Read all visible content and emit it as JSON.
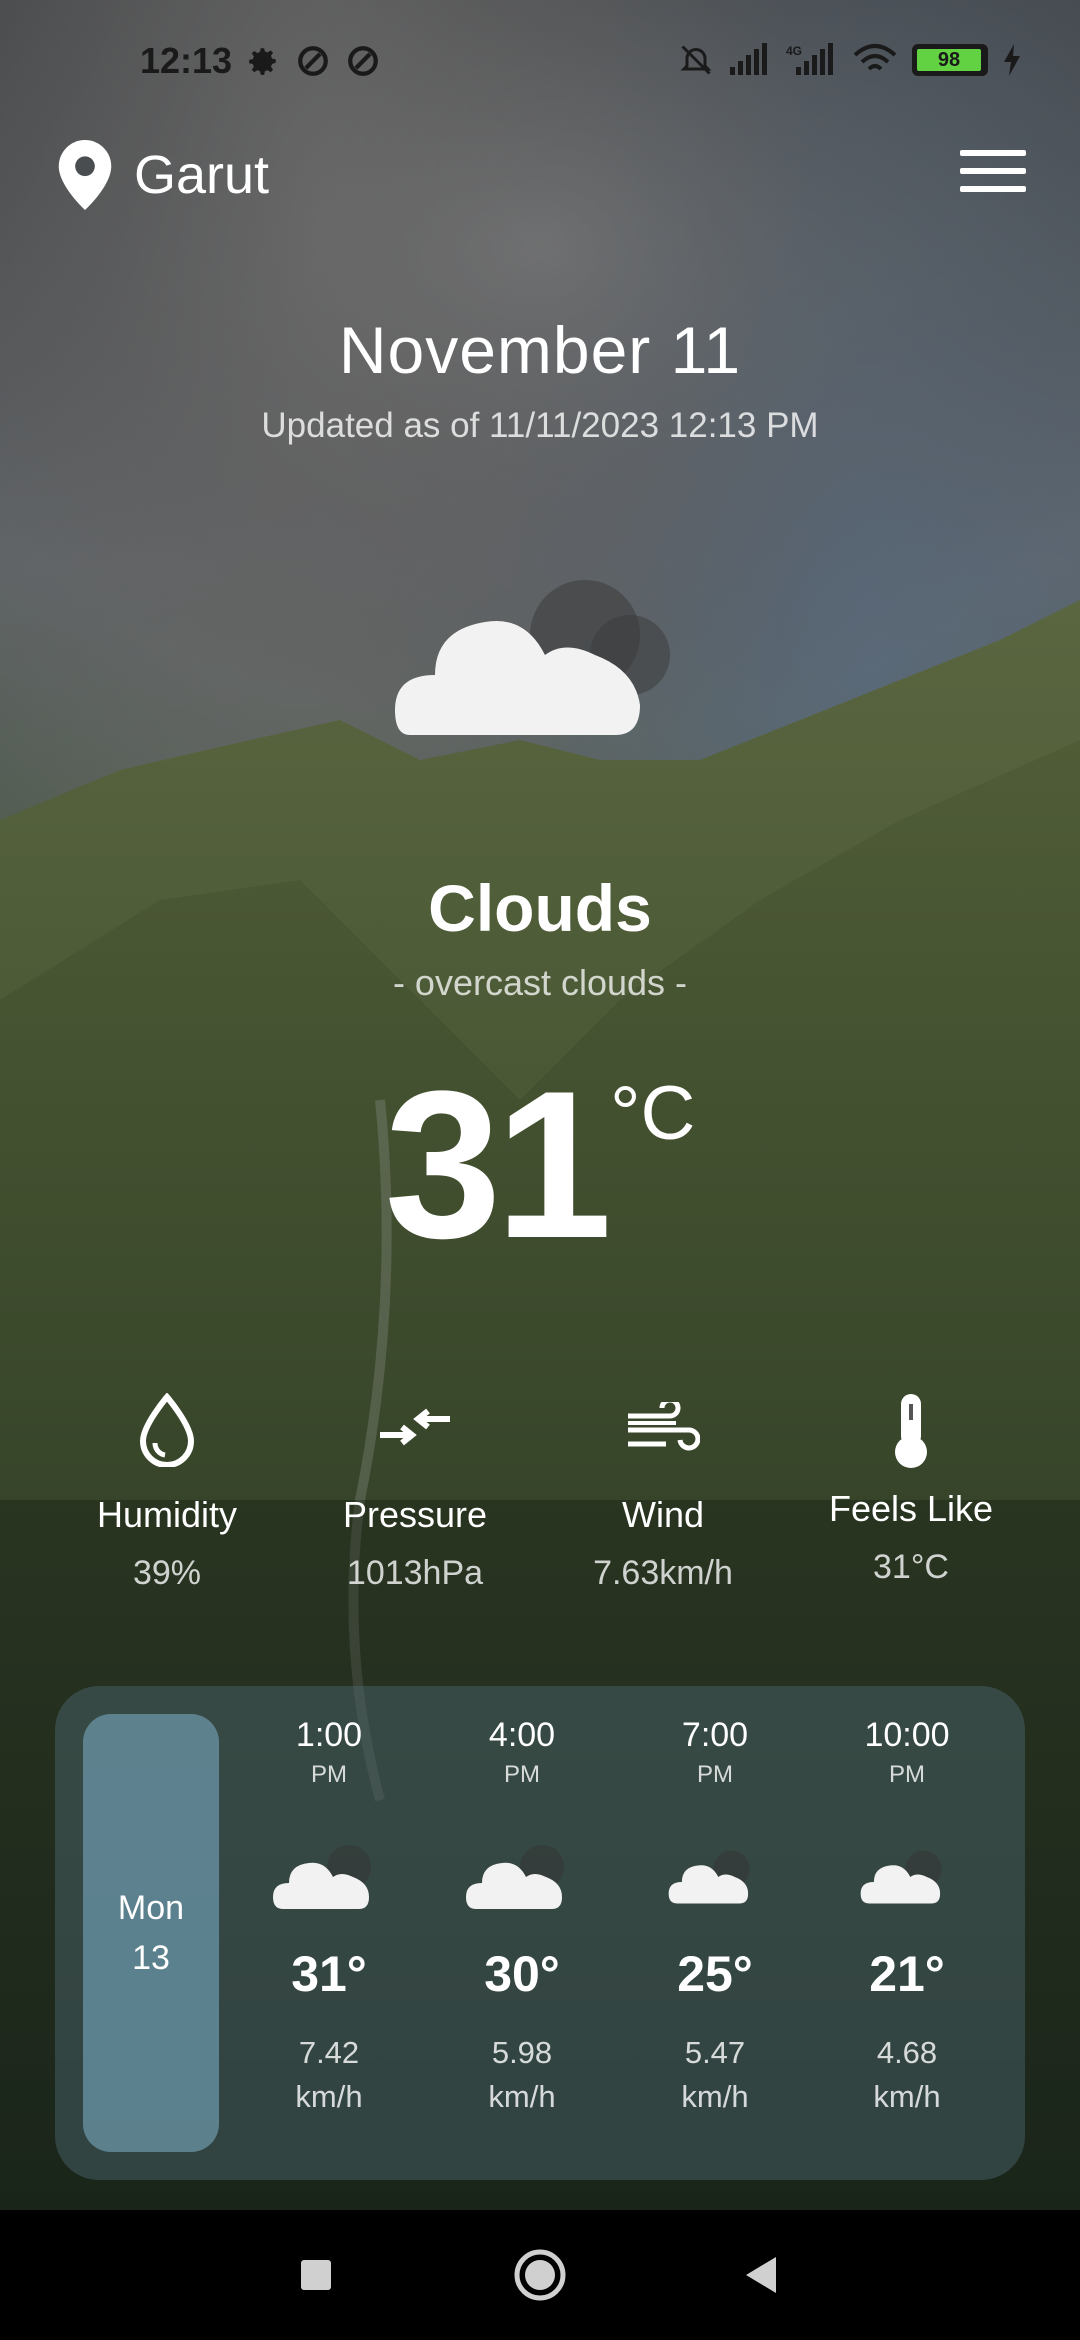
{
  "status_bar": {
    "time": "12:13",
    "battery_level": "98",
    "network": "4G"
  },
  "header": {
    "location": "Garut",
    "icons": {
      "location": "map-pin-icon",
      "menu": "hamburger-menu-icon"
    }
  },
  "summary": {
    "date": "November 11",
    "updated": "Updated as of 11/11/2023 12:13 PM",
    "condition": "Clouds",
    "description": "- overcast clouds -",
    "temperature": "31",
    "temperature_unit": "°C"
  },
  "stats": [
    {
      "label": "Humidity",
      "value": "39%",
      "icon": "droplet-icon"
    },
    {
      "label": "Pressure",
      "value": "1013hPa",
      "icon": "pressure-arrows-icon"
    },
    {
      "label": "Wind",
      "value": "7.63km/h",
      "icon": "wind-icon"
    },
    {
      "label": "Feels Like",
      "value": "31°C",
      "icon": "thermometer-icon"
    }
  ],
  "forecast": {
    "day_name": "Mon",
    "day_number": "13",
    "slots": [
      {
        "time": "1:00",
        "ampm": "PM",
        "temp": "31°",
        "speed": "7.42",
        "unit": "km/h",
        "icon": "cloud-icon"
      },
      {
        "time": "4:00",
        "ampm": "PM",
        "temp": "30°",
        "speed": "5.98",
        "unit": "km/h",
        "icon": "cloud-icon"
      },
      {
        "time": "7:00",
        "ampm": "PM",
        "temp": "25°",
        "speed": "5.47",
        "unit": "km/h",
        "icon": "cloud-icon"
      },
      {
        "time": "10:00",
        "ampm": "PM",
        "temp": "21°",
        "speed": "4.68",
        "unit": "km/h",
        "icon": "cloud-icon"
      }
    ]
  },
  "colors": {
    "battery_fill": "#62d142",
    "card_background": "rgba(80,110,120,0.42)",
    "day_pill": "rgba(100,140,155,0.85)"
  }
}
